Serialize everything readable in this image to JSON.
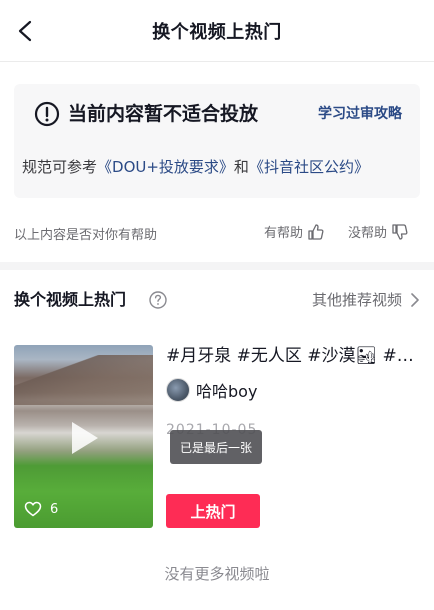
{
  "header": {
    "title": "换个视频上热门"
  },
  "notice": {
    "title": "当前内容暂不适合投放",
    "link": "学习过审攻略",
    "line_prefix": "规范可参考",
    "link_dou": "《DOU+投放要求》",
    "line_and": "和",
    "link_rules": "《抖音社区公约》"
  },
  "feedback": {
    "question": "以上内容是否对你有帮助",
    "helpful": "有帮助",
    "not_helpful": "没帮助"
  },
  "section": {
    "title": "换个视频上热门",
    "others": "其他推荐视频"
  },
  "video": {
    "title": "#月牙泉 #无人区 #沙漠🏜 #大西北",
    "author": "哈哈boy",
    "date": "2021-10-05",
    "likes": "6",
    "button": "上热门"
  },
  "toast": "已是最后一张",
  "footer": {
    "no_more": "没有更多视频啦"
  },
  "colors": {
    "accent": "#fe2c55",
    "link": "#2b4a86"
  },
  "icons": {
    "back": "chevron-left-icon",
    "alert": "exclamation-circle-icon",
    "thumbs_up": "thumbs-up-icon",
    "thumbs_down": "thumbs-down-icon",
    "help": "question-circle-icon",
    "arrow": "chevron-right-icon",
    "play": "play-icon",
    "heart": "heart-icon"
  }
}
